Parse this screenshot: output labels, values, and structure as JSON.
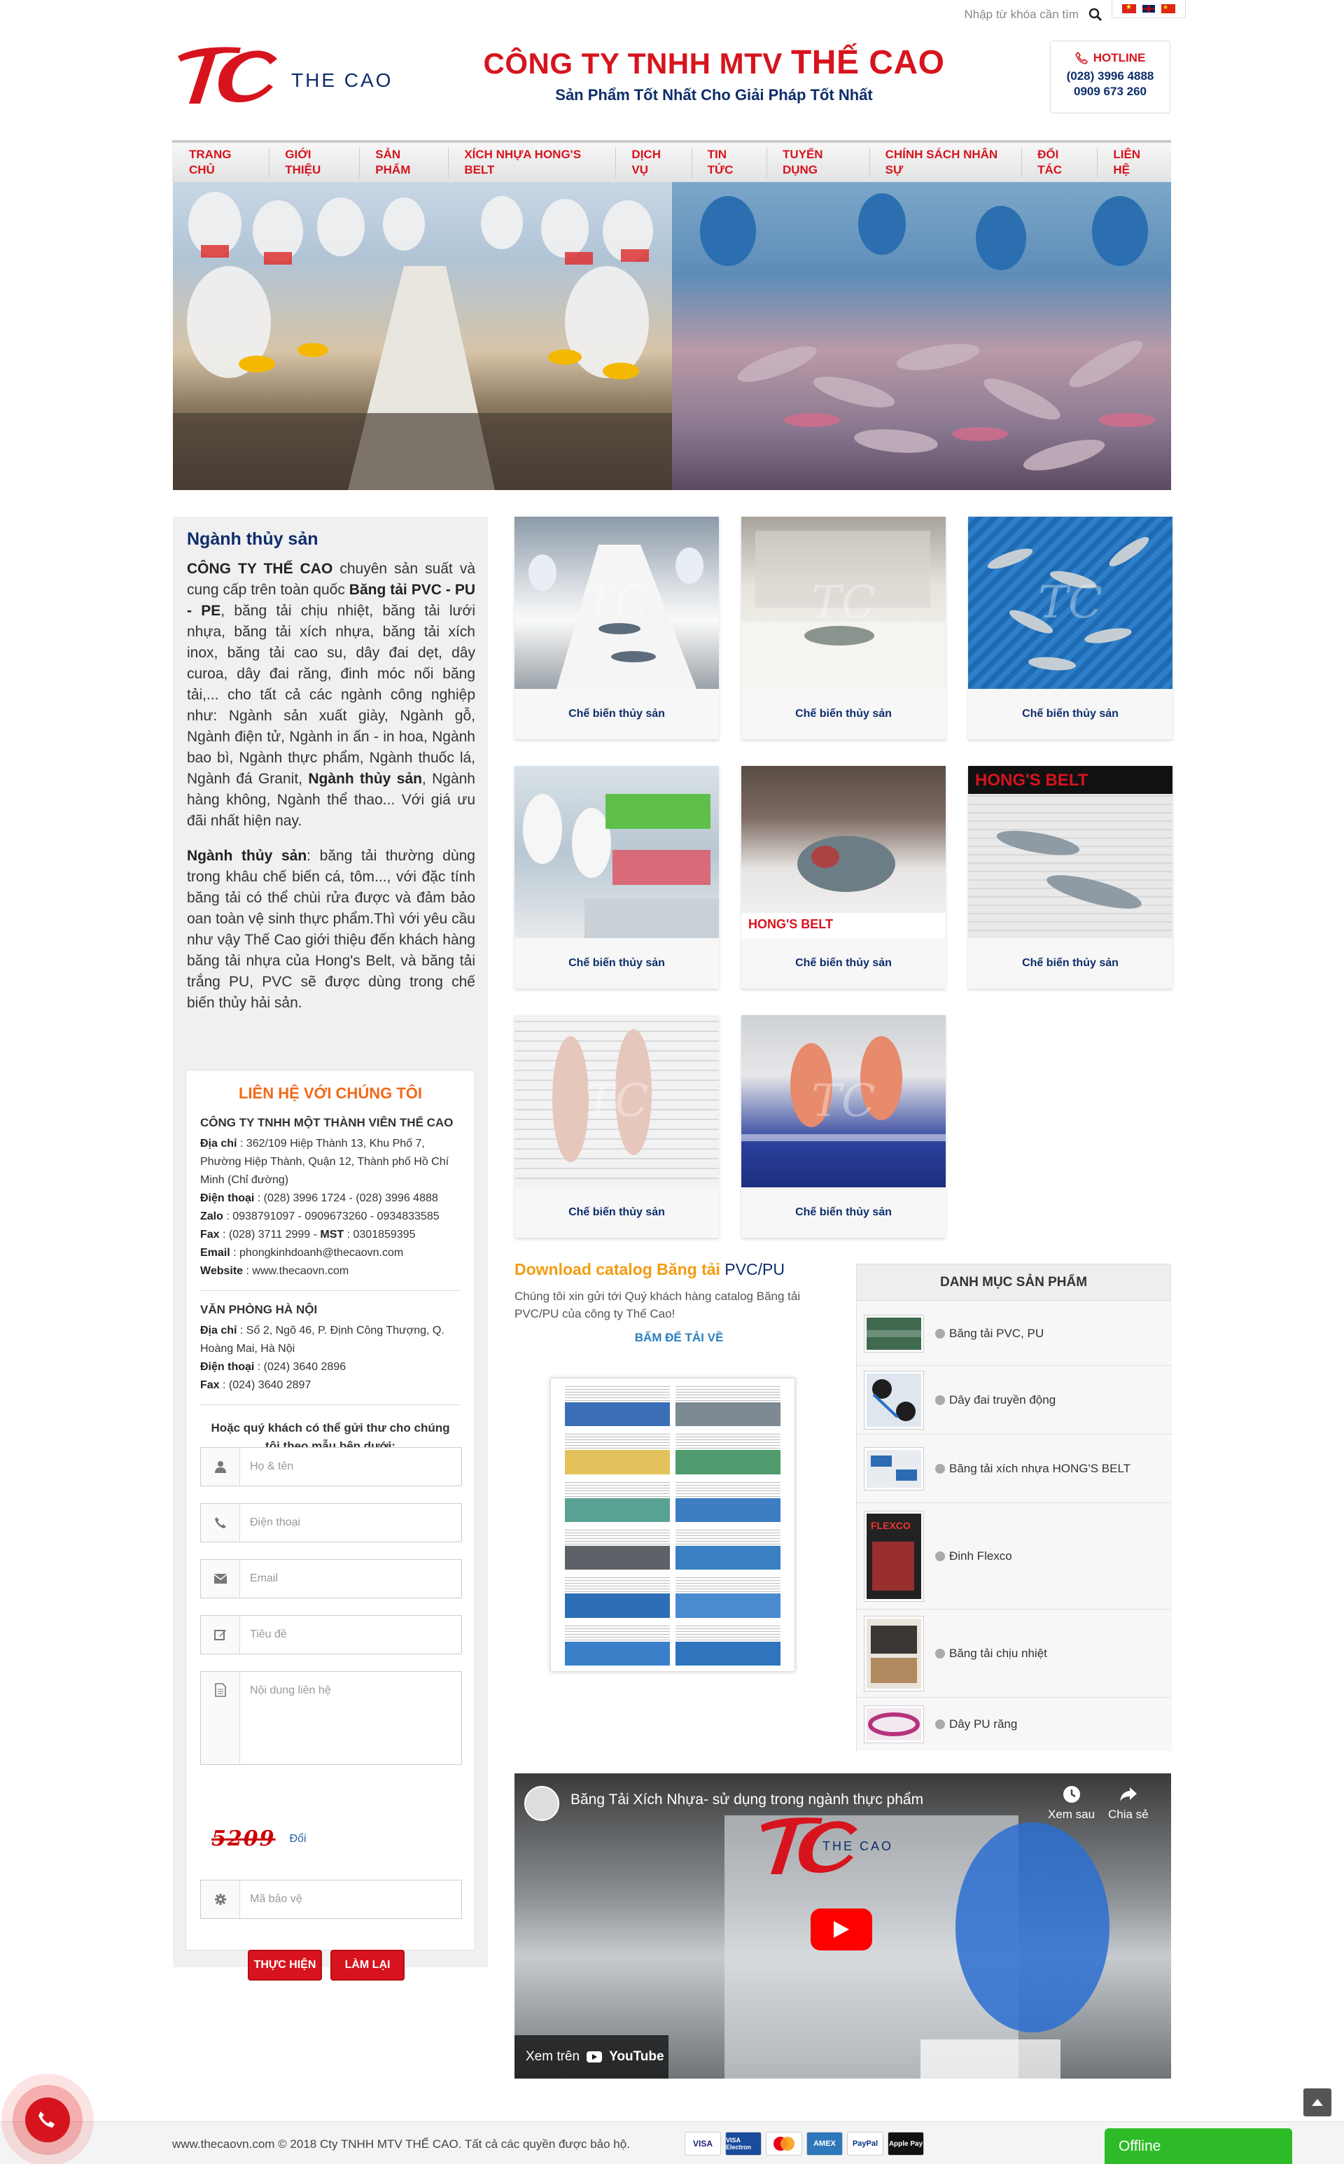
{
  "topbar": {
    "search_placeholder": "Nhập từ khóa cần tìm",
    "languages": [
      "vi",
      "en",
      "zh"
    ]
  },
  "header": {
    "logo_text": "THE CAO",
    "company_prefix": "CÔNG TY TNHH MTV",
    "company_name": "THẾ CAO",
    "slogan": "Sản Phẩm Tốt Nhất Cho Giải Pháp Tốt Nhất",
    "hotline_label": "HOTLINE",
    "hotline_1": "(028) 3996 4888",
    "hotline_2": "0909 673 260"
  },
  "nav": {
    "items": [
      {
        "label": "TRANG CHỦ"
      },
      {
        "label": "GIỚI THIỆU"
      },
      {
        "label": "SẢN PHẨM"
      },
      {
        "label": "XÍCH NHỰA HONG'S BELT"
      },
      {
        "label": "DỊCH VỤ"
      },
      {
        "label": "TIN TỨC"
      },
      {
        "label": "TUYỂN DỤNG"
      },
      {
        "label": "CHÍNH SÁCH NHÂN SỰ"
      },
      {
        "label": "ĐỐI TÁC"
      },
      {
        "label": "LIÊN HỆ"
      }
    ]
  },
  "sidebar": {
    "title": "Ngành thủy sản",
    "p1": {
      "a": "CÔNG TY THẾ CAO",
      "b": " chuyên sản suất và cung cấp trên toàn quốc ",
      "c": "Băng tải PVC - PU - PE",
      "d": ", băng tải chịu nhiệt, băng tải lưới nhựa, băng tải xích nhựa, băng tải xích inox, băng tải cao su, dây đai dẹt, dây curoa, dây đai răng, đinh móc nối băng tải,... cho tất cả các ngành công nghiệp như: Ngành sản xuất giày, Ngành gỗ, Ngành điện tử, Ngành in ấn - in hoa, Ngành bao bì, Ngành thực phẩm, Ngành thuốc lá, Ngành đá Granit, ",
      "e": "Ngành thủy sản",
      "f": ", Ngành hàng không, Ngành thể thao... Với giá ưu đãi nhất hiện nay."
    },
    "p2": {
      "a": "Ngành thủy sản",
      "b": ": băng tải thường dùng trong khâu chế biến cá, tôm..., với đặc tính băng tải có thể chùi rửa được và đảm bảo oan toàn vệ sinh thực phẩm.Thì với yêu cầu như vậy Thế Cao giới thiệu đến khách hàng băng tải nhựa của Hong's Belt, và băng tải trắng PU, PVC sẽ được dùng trong chế biến thủy hải sản."
    }
  },
  "contact": {
    "title": "LIÊN HỆ VỚI CHÚNG TÔI",
    "company": "CÔNG TY TNHH MỘT THÀNH VIÊN THẾ CAO",
    "address_label": "Địa chỉ",
    "address": " : 362/109 Hiệp Thành 13, Khu Phố 7, Phường Hiệp Thành, Quận 12, Thành phố Hồ Chí Minh (Chỉ đường)",
    "phone_label": "Điện thoại",
    "phone": " : (028) 3996 1724 - (028) 3996 4888",
    "zalo_label": "Zalo",
    "zalo": " : 0938791097 - 0909673260 - 0934833585",
    "fax_label": "Fax",
    "fax": " : (028) 3711 2999 - ",
    "mst_label": "MST",
    "mst": " : 0301859395",
    "email_label": "Email",
    "email": " : phongkinhdoanh@thecaovn.com",
    "website_label": "Website",
    "website": " : www.thecaovn.com",
    "hn_title": "VĂN PHÒNG HÀ NỘI",
    "hn_address": " : Số 2, Ngõ 46, P. Định Công Thượng, Q. Hoàng Mai, Hà Nội",
    "hn_phone": " : (024) 3640 2896",
    "hn_fax": " : (024) 3640 2897",
    "form_intro": "Hoặc quý khách có thể gửi thư cho chúng tôi theo mẫu bên dưới:",
    "ph_name": "Họ & tên",
    "ph_phone": "Điện thoại",
    "ph_email": "Email",
    "ph_subject": "Tiêu đề",
    "ph_message": "Nội dung liên hệ",
    "captcha_code": "5209",
    "captcha_change": "Đổi",
    "ph_captcha": "Mã bảo vệ",
    "submit": "THỰC HIỆN",
    "reset": "LÀM LẠI"
  },
  "products": [
    {
      "caption": "Chế biến thủy sản"
    },
    {
      "caption": "Chế biến thủy sản"
    },
    {
      "caption": "Chế biến thủy sản"
    },
    {
      "caption": "Chế biến thủy sản"
    },
    {
      "caption": "Chế biến thủy sản"
    },
    {
      "caption": "Chế biến thủy sản"
    },
    {
      "caption": "Chế biến thủy sản"
    },
    {
      "caption": "Chế biến thủy sản"
    }
  ],
  "download": {
    "title_a": "Download catalog Băng tải",
    "title_b": " PVC/PU",
    "desc": "Chúng tôi xin gửi tới Quý khách hàng catalog Băng tải PVC/PU của công ty Thế Cao!",
    "button": "BẤM ĐỂ TẢI VỀ"
  },
  "categories": {
    "title": "DANH MỤC SẢN PHẨM",
    "items": [
      {
        "label": "Băng tải PVC, PU"
      },
      {
        "label": "Dây đai truyền động"
      },
      {
        "label": "Băng tải xích nhựa HONG'S BELT"
      },
      {
        "label": "Đinh Flexco"
      },
      {
        "label": "Băng tải chịu nhiệt"
      },
      {
        "label": "Dây PU răng"
      }
    ]
  },
  "video": {
    "title": "Băng Tải Xích Nhựa- sử dụng trong ngành thực phẩm",
    "watch_later": "Xem sau",
    "share": "Chia sẻ",
    "watch_on": "Xem trên",
    "youtube": "YouTube"
  },
  "footer": {
    "copyright": "www.thecaovn.com © 2018 Cty TNHH MTV THẾ CAO. Tất cả các quyền được bảo hộ.",
    "payments": [
      "VISA",
      "VISA Electron",
      "MasterCard",
      "AMEX",
      "PayPal",
      "Apple Pay"
    ]
  },
  "chat": {
    "status": "Offline"
  },
  "colors": {
    "brand_red": "#d7141e",
    "navy": "#0d2d6b",
    "orange": "#f06a1a",
    "green": "#2dbc28"
  }
}
